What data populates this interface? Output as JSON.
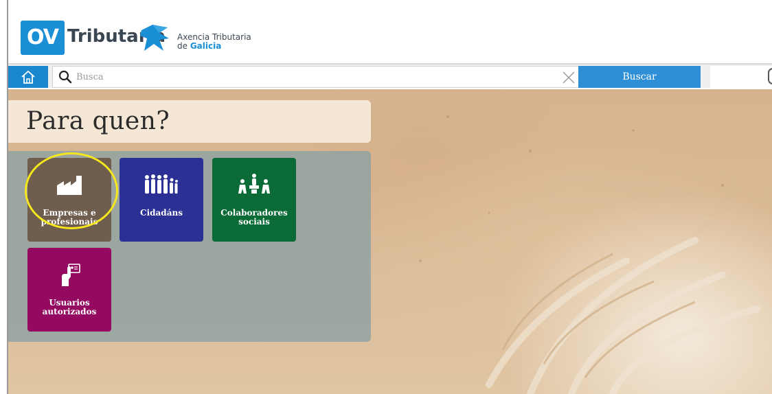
{
  "header": {
    "logo_ov": "OV",
    "logo_tributaria": "Tributaria",
    "agency_line1": "Axencia Tributaria",
    "agency_line2_prefix": "de ",
    "agency_line2_bold": "Galicia"
  },
  "search": {
    "placeholder": "Busca",
    "value": "",
    "button_label": "Buscar"
  },
  "hero": {
    "title": "Para quen?"
  },
  "tiles": [
    {
      "label": "Empresas e profesionais",
      "icon": "factory-icon",
      "color": "#6f5d4d",
      "highlighted": true
    },
    {
      "label": "Cidadáns",
      "icon": "people-group-icon",
      "color": "#2b3094"
    },
    {
      "label": "Colaboradores sociais",
      "icon": "collaborators-icon",
      "color": "#0b6b37"
    },
    {
      "label": "Usuarios autorizados",
      "icon": "hand-card-icon",
      "color": "#930a60"
    }
  ],
  "colors": {
    "brand_blue": "#1a8fd6",
    "search_button": "#2e8fd6",
    "highlight": "#f5e61e"
  }
}
